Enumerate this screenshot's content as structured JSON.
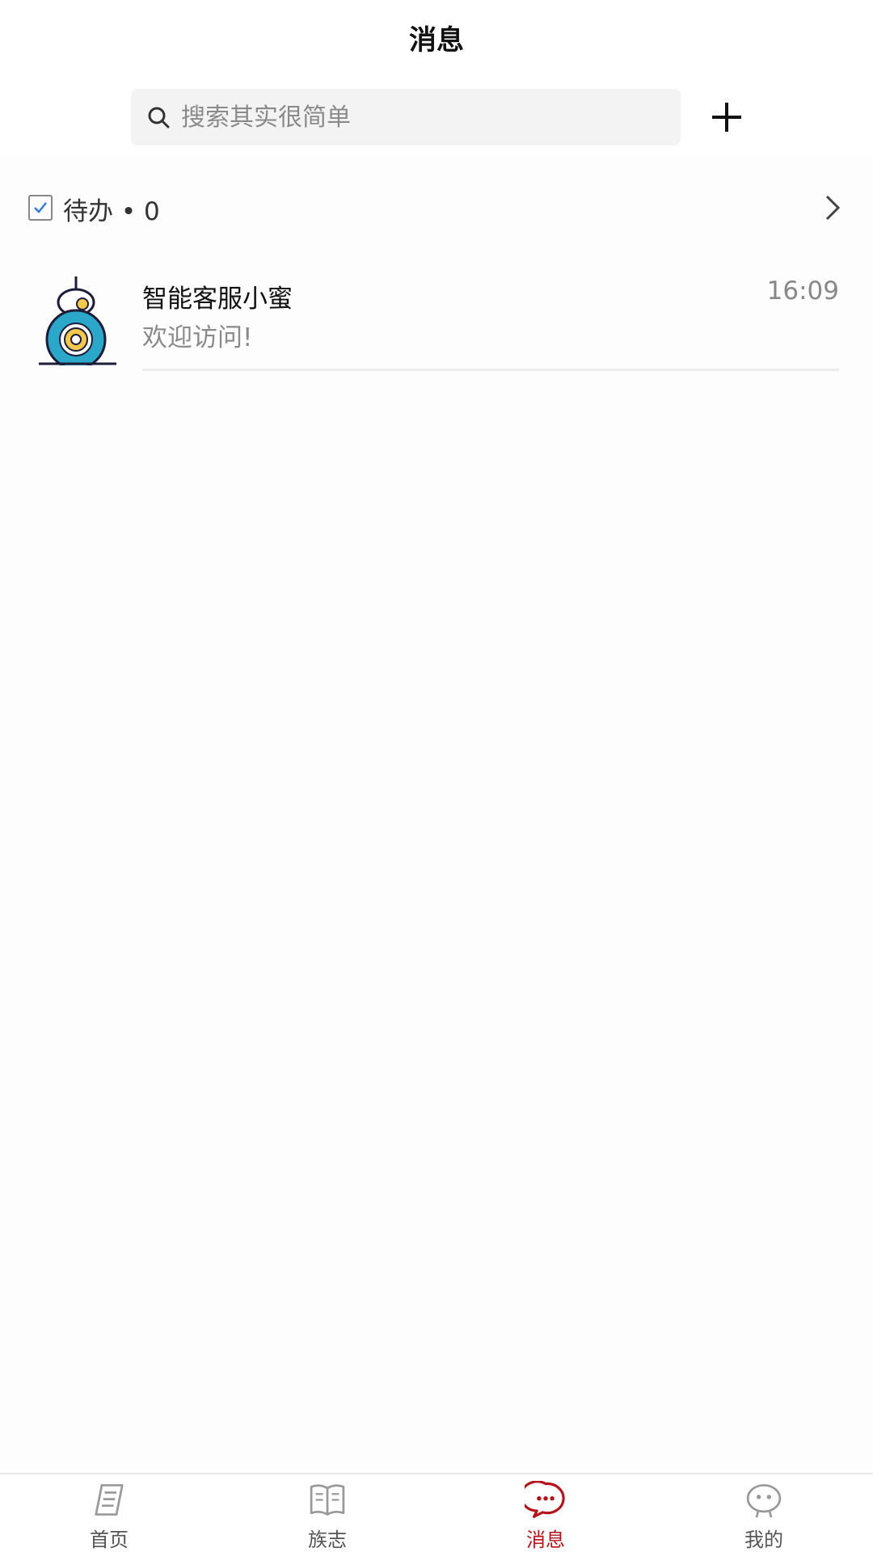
{
  "header": {
    "title": "消息"
  },
  "search": {
    "placeholder": "搜索其实很简单"
  },
  "todo": {
    "label": "待办",
    "separator": "•",
    "count": "0"
  },
  "conversations": [
    {
      "name": "智能客服小蜜",
      "time": "16:09",
      "preview": "欢迎访问!",
      "avatar_icon": "robot-avatar-icon"
    }
  ],
  "tabbar": {
    "active_color": "#b3141c",
    "items": [
      {
        "label": "首页",
        "icon": "notebook-icon",
        "active": false
      },
      {
        "label": "族志",
        "icon": "book-icon",
        "active": false
      },
      {
        "label": "消息",
        "icon": "chat-bubble-icon",
        "active": true
      },
      {
        "label": "我的",
        "icon": "robot-face-icon",
        "active": false
      }
    ]
  }
}
